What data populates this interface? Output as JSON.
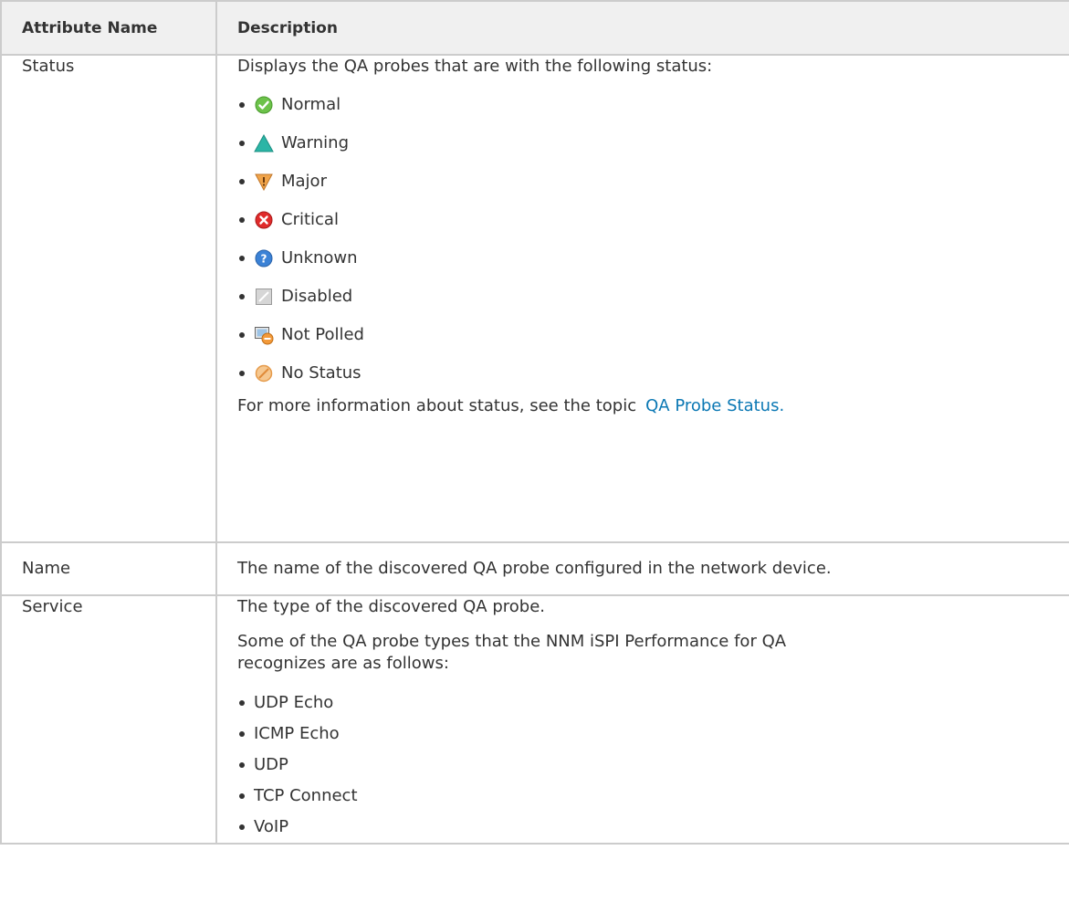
{
  "table": {
    "headers": [
      "Attribute Name",
      "Description"
    ],
    "status_row": {
      "attribute": "Status",
      "intro": "Displays the QA probes that are with the following status:",
      "items": [
        {
          "icon": "normal-icon",
          "label": "Normal"
        },
        {
          "icon": "warning-icon",
          "label": "Warning"
        },
        {
          "icon": "major-icon",
          "label": "Major"
        },
        {
          "icon": "critical-icon",
          "label": "Critical"
        },
        {
          "icon": "unknown-icon",
          "label": "Unknown"
        },
        {
          "icon": "disabled-icon",
          "label": "Disabled"
        },
        {
          "icon": "not-polled-icon",
          "label": "Not Polled"
        },
        {
          "icon": "no-status-icon",
          "label": "No Status"
        }
      ],
      "more_info_prefix": "For more information about status, see the topic",
      "more_info_link": "QA Probe Status."
    },
    "name_row": {
      "attribute": "Name",
      "description": "The name of the discovered QA probe configured in the network device."
    },
    "service_row": {
      "attribute": "Service",
      "description": "The type of the discovered QA probe.",
      "intro": "Some of the QA probe types that the NNM iSPI Performance for QA recognizes are as follows:",
      "types": [
        "UDP Echo",
        "ICMP Echo",
        "UDP",
        "TCP Connect",
        "VoIP"
      ]
    }
  },
  "colors": {
    "link": "#0b78b4",
    "header_bg": "#f0f0f0",
    "border": "#cccccc"
  }
}
